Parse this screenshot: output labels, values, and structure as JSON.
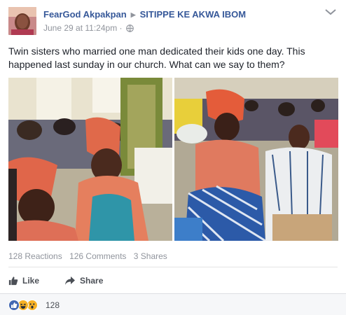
{
  "post": {
    "author": "FearGod Akpakpan",
    "group": "SITIPPE KE AKWA IBOM",
    "timestamp": "June 29 at 11:24pm",
    "separator": "·",
    "text": "Twin sisters who married one man dedicated their kids one day. This happened last sunday in our church. What can we say to them?"
  },
  "stats": {
    "reactions": "128 Reactions",
    "comments": "126 Comments",
    "shares": "3 Shares"
  },
  "actions": {
    "like_label": "Like",
    "share_label": "Share"
  },
  "reactions_bar": {
    "count": "128",
    "types": [
      "like-icon",
      "haha-icon",
      "wow-icon"
    ]
  },
  "icons": {
    "share_arrow": "share-arrow-icon",
    "thumb": "thumbs-up-icon",
    "globe": "globe-icon",
    "options": "more-options-icon"
  },
  "colors": {
    "link": "#365899",
    "meta": "#90949c",
    "text": "#1d2129",
    "like_blue": "#4267b2",
    "haha_yellow": "#f7b125"
  }
}
